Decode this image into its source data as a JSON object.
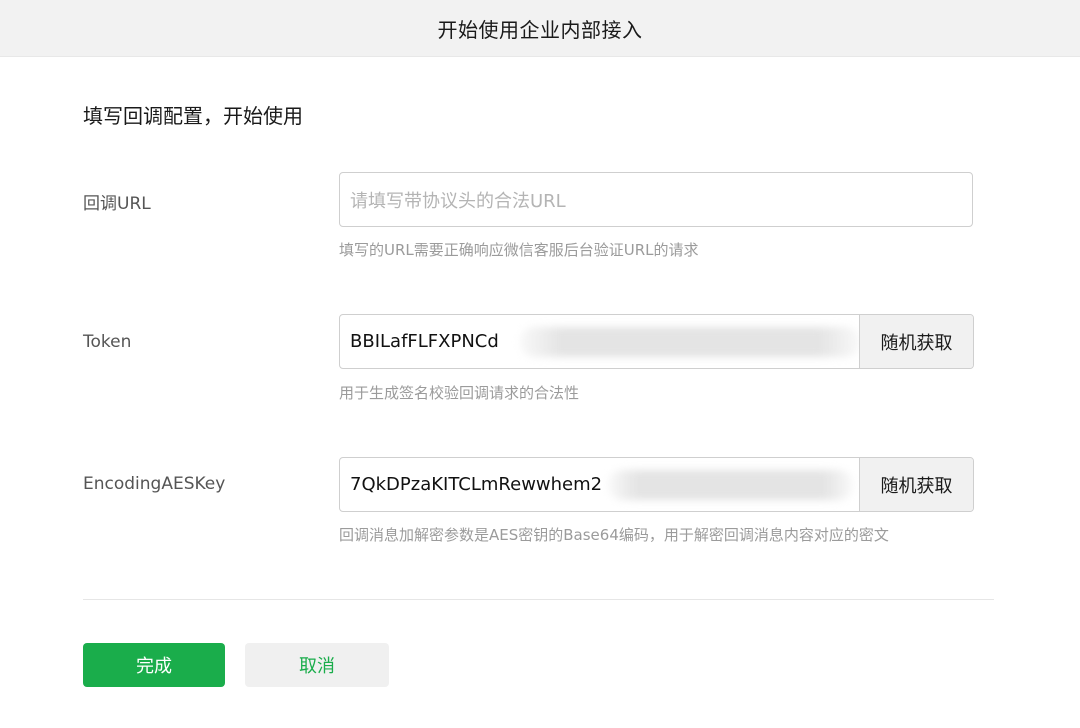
{
  "window": {
    "title": "开始使用企业内部接入"
  },
  "section": {
    "title": "填写回调配置，开始使用"
  },
  "fields": {
    "callback_url": {
      "label": "回调URL",
      "placeholder": "请填写带协议头的合法URL",
      "value": "",
      "hint": "填写的URL需要正确响应微信客服后台验证URL的请求"
    },
    "token": {
      "label": "Token",
      "value": "BBILafFLFXPNCd",
      "button_label": "随机获取",
      "hint": "用于生成签名校验回调请求的合法性"
    },
    "aes_key": {
      "label": "EncodingAESKey",
      "value": "7QkDPzaKITCLmRewwhem2",
      "button_label": "随机获取",
      "hint": "回调消息加解密参数是AES密钥的Base64编码，用于解密回调消息内容对应的密文"
    }
  },
  "actions": {
    "confirm_label": "完成",
    "cancel_label": "取消"
  },
  "colors": {
    "primary": "#1aad4b",
    "title_bar": "#f2f2f2"
  }
}
